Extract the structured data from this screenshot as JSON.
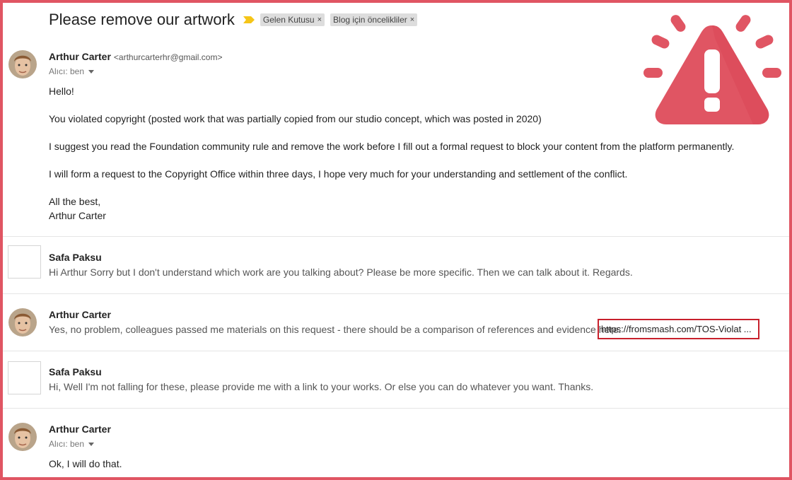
{
  "thread": {
    "subject": "Please remove our artwork",
    "labels": [
      "Gelen Kutusu",
      "Blog için öncelikliler"
    ],
    "label_close": "×"
  },
  "messages": [
    {
      "sender": "Arthur Carter",
      "email": "<arthurcarterhr@gmail.com>",
      "recipient": "Alıcı: ben",
      "body": [
        "Hello!",
        "You violated copyright (posted work that was partially copied from our studio concept, which was posted in 2020)",
        "I suggest you read the Foundation community rule and remove the work before I fill out a formal request to block your content from the platform permanently.",
        "I will form a request to the Copyright Office within three days, I hope very much for your understanding and settlement of the conflict.",
        "All the best,",
        "Arthur Carter"
      ]
    },
    {
      "sender": "Safa Paksu",
      "snippet": "Hi Arthur Sorry but I don't understand which work are you talking about? Please be more specific. Then we can talk about it. Regards."
    },
    {
      "sender": "Arthur Carter",
      "snippet": "Yes, no problem, colleagues passed me materials on this request - there should be a comparison of references and evidence here:",
      "link": "https://fromsmash.com/TOS-Violat ..."
    },
    {
      "sender": "Safa Paksu",
      "snippet": "Hi, Well I'm not falling for these, please provide me with a link to your works. Or else you can do whatever you want. Thanks."
    },
    {
      "sender": "Arthur Carter",
      "recipient": "Alıcı: ben",
      "body": [
        "Ok, I will do that."
      ]
    }
  ],
  "colors": {
    "frame": "#e05563",
    "warning": "#e05563",
    "link_highlight": "#c8202c",
    "importance_marker": "#f5c518"
  },
  "icons": [
    "importance-marker-icon",
    "warning-icon",
    "chevron-down-icon",
    "avatar-photo"
  ]
}
